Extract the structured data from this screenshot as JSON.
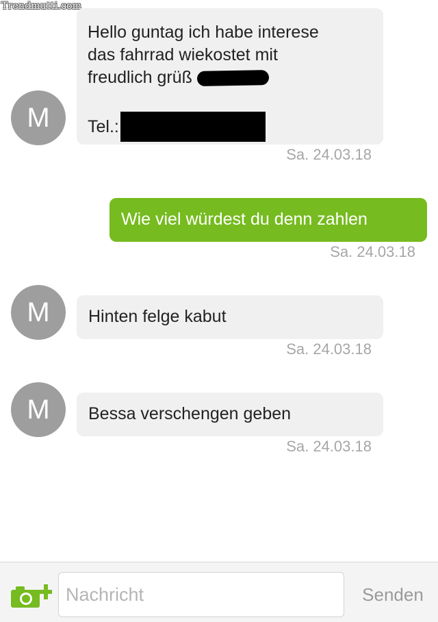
{
  "watermark": "Trendmutti.com",
  "contact_initial": "M",
  "messages": [
    {
      "direction": "incoming",
      "lines": [
        "Hello guntag ich habe interese",
        "das fahrrad wiekostet mit",
        "freudlich grüß"
      ],
      "phone_label": "Tel.:",
      "redacted": true,
      "timestamp": "Sa. 24.03.18"
    },
    {
      "direction": "outgoing",
      "text": "Wie viel würdest du denn zahlen",
      "timestamp": "Sa. 24.03.18"
    },
    {
      "direction": "incoming",
      "text": "Hinten felge kabut",
      "timestamp": "Sa. 24.03.18"
    },
    {
      "direction": "incoming",
      "text": "Bessa verschengen geben",
      "timestamp": "Sa. 24.03.18"
    }
  ],
  "composer": {
    "placeholder": "Nachricht",
    "send_label": "Senden",
    "attach_icon": "camera-plus-icon"
  },
  "colors": {
    "outgoing_bubble": "#76bb1f",
    "incoming_bubble": "#f0f0f0",
    "avatar": "#9e9e9e",
    "timestamp": "#a6a6a6",
    "accent_icon": "#76bb1f"
  }
}
